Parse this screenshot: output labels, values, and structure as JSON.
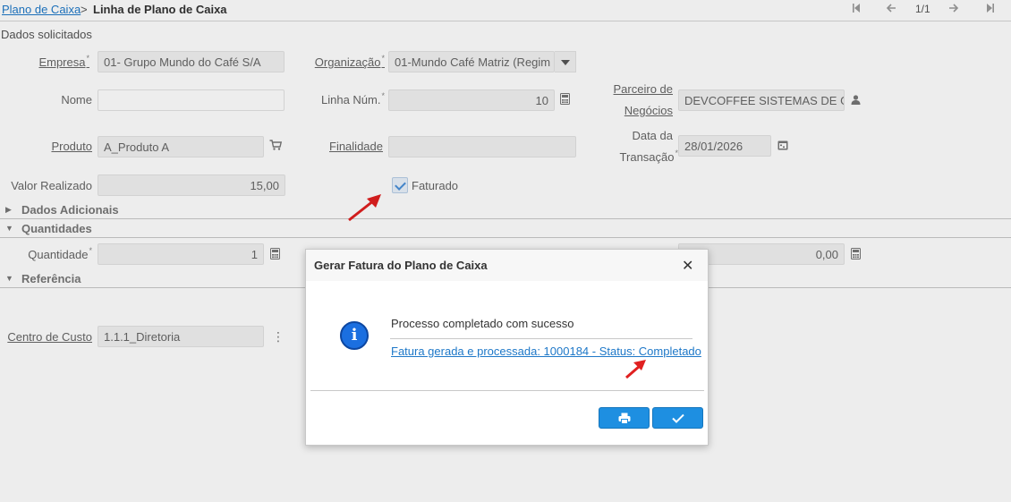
{
  "breadcrumb": {
    "parent": "Plano de Caixa",
    "separator": ">",
    "current": "Linha de Plano de Caixa"
  },
  "navigation": {
    "record_counter": "1/1"
  },
  "section_title": "Dados solicitados",
  "form": {
    "empresa": {
      "label": "Empresa",
      "value": "01- Grupo Mundo do Café S/A"
    },
    "organizacao": {
      "label": "Organização",
      "value": "01-Mundo Café Matriz (Regim"
    },
    "nome": {
      "label": "Nome",
      "value": ""
    },
    "linha_num": {
      "label": "Linha Núm.",
      "value": "10"
    },
    "parceiro": {
      "label_line1": "Parceiro de",
      "label_line2": "Negócios",
      "value": "DEVCOFFEE SISTEMAS DE GES"
    },
    "produto": {
      "label": "Produto",
      "value": "A_Produto A"
    },
    "finalidade": {
      "label": "Finalidade",
      "value": ""
    },
    "data_transacao": {
      "label_line1": "Data da",
      "label_line2": "Transação",
      "value": "28/01/2026"
    },
    "valor_realizado": {
      "label": "Valor Realizado",
      "value": "15,00"
    },
    "faturado": {
      "label": "Faturado",
      "checked": true
    }
  },
  "groups": {
    "dados_adicionais": "Dados Adicionais",
    "quantidades": "Quantidades",
    "referencia": "Referência"
  },
  "quantidades": {
    "quantidade": {
      "label": "Quantidade",
      "value": "1"
    },
    "other_value": "0,00"
  },
  "referencia": {
    "centro_custo": {
      "label": "Centro de Custo",
      "value": "1.1.1_Diretoria"
    }
  },
  "dialog": {
    "title": "Gerar Fatura do Plano de Caixa",
    "message": "Processo completado com sucesso",
    "link": "Fatura gerada e processada: 1000184 - Status: Completado",
    "close_icon": "close-icon",
    "print_icon": "printer-icon",
    "ok_icon": "check-icon"
  },
  "colors": {
    "accent": "#1e8fe1",
    "link": "#1e78c8",
    "annotation_arrow": "#e02020"
  }
}
